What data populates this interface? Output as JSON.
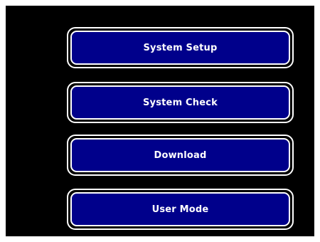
{
  "menu": {
    "buttons": [
      {
        "label": "System Setup"
      },
      {
        "label": "System Check"
      },
      {
        "label": "Download"
      },
      {
        "label": "User Mode"
      }
    ]
  },
  "colors": {
    "background": "#000000",
    "button_fill": "#00008b",
    "button_border": "#ffffff",
    "text": "#ffffff"
  }
}
